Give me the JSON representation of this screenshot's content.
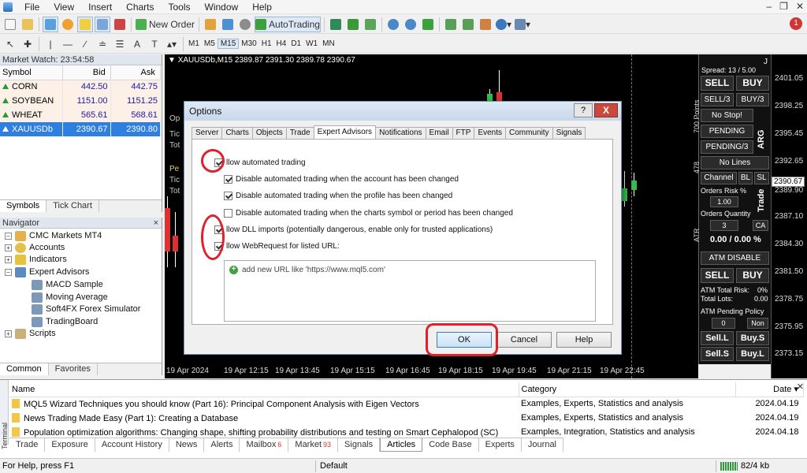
{
  "menu": [
    "File",
    "View",
    "Insert",
    "Charts",
    "Tools",
    "Window",
    "Help"
  ],
  "toolbar": {
    "new_order": "New Order",
    "autotrading": "AutoTrading"
  },
  "timeframes": [
    "M1",
    "M5",
    "M15",
    "M30",
    "H1",
    "H4",
    "D1",
    "W1",
    "MN"
  ],
  "notification_count": "1",
  "market_watch": {
    "title": "Market Watch: 23:54:58",
    "headers": [
      "Symbol",
      "Bid",
      "Ask"
    ],
    "rows": [
      {
        "symbol": "CORN",
        "bid": "442.50",
        "ask": "442.75"
      },
      {
        "symbol": "SOYBEAN",
        "bid": "1151.00",
        "ask": "1151.25"
      },
      {
        "symbol": "WHEAT",
        "bid": "565.61",
        "ask": "568.61"
      },
      {
        "symbol": "XAUUSDb",
        "bid": "2390.67",
        "ask": "2390.80"
      }
    ],
    "tabs": [
      "Symbols",
      "Tick Chart"
    ]
  },
  "navigator": {
    "title": "Navigator",
    "close": "×",
    "items": [
      "CMC Markets MT4",
      "Accounts",
      "Indicators",
      "Expert Advisors",
      "MACD Sample",
      "Moving Average",
      "Soft4FX Forex Simulator",
      "TradingBoard",
      "Scripts"
    ],
    "tabs": [
      "Common",
      "Favorites"
    ]
  },
  "chart": {
    "header": "XAUUSDb,M15  2389.87 2391.30 2389.78 2390.67",
    "hints": [
      "Op",
      "Pe",
      "Tic",
      "Tot",
      "Tic",
      "Tot"
    ],
    "x_labels": [
      "19 Apr 2024",
      "19 Apr 12:15",
      "19 Apr 13:45",
      "19 Apr 15:15",
      "19 Apr 16:45",
      "19 Apr 18:15",
      "19 Apr 19:45",
      "19 Apr 21:15",
      "19 Apr 22:45"
    ],
    "price_labels": [
      "2401.05",
      "2398.25",
      "2395.45",
      "2392.65",
      "2389.90",
      "2387.10",
      "2384.30",
      "2381.50",
      "2378.75",
      "2375.95",
      "2373.15"
    ],
    "current_price": "2390.67"
  },
  "panel": {
    "spread": "Spread: 13 / 5.00",
    "j": "J",
    "sell": "SELL",
    "buy": "BUY",
    "sell3": "SELL/3",
    "buy3": "BUY/3",
    "nostop": "No Stop!",
    "pending": "PENDING",
    "pending3": "PENDING/3",
    "nolines": "No Lines",
    "channel": "Channel",
    "bl": "BL",
    "sl": "SL",
    "orders_risk": "Orders Risk %",
    "risk_value": "1.00",
    "orders_qty": "Orders Quantity",
    "qty_value": "3",
    "ca": "CA",
    "pct": "0.00 / 0.00 %",
    "atm_disable": "ATM DISABLE",
    "sell2": "SELL",
    "buy2": "BUY",
    "atm_total_risk": "ATM Total Risk:",
    "atm_total_risk_val": "0%",
    "total_lots": "Total Lots:",
    "total_lots_val": "0.00",
    "atm_pending": "ATM Pending Policy",
    "pending_val": "0",
    "non": "Non",
    "sell_l": "Sell.L",
    "buy_s": "Buy.S",
    "sell_s": "Sell.S",
    "buy_l": "Buy.L",
    "v_700": "700 Points",
    "v_arg": "ARG",
    "v_478": "478",
    "v_trade": "Trade",
    "v_atr": "ATR"
  },
  "dialog": {
    "title": "Options",
    "help": "?",
    "close": "X",
    "tabs": [
      "Server",
      "Charts",
      "Objects",
      "Trade",
      "Expert Advisors",
      "Notifications",
      "Email",
      "FTP",
      "Events",
      "Community",
      "Signals"
    ],
    "active_tab": "Expert Advisors",
    "options": [
      {
        "label": "llow automated trading",
        "checked": true
      },
      {
        "label": "Disable automated trading when the account has been changed",
        "checked": true
      },
      {
        "label": "Disable automated trading when the profile has been changed",
        "checked": true
      },
      {
        "label": "Disable automated trading when the charts symbol or period has been changed",
        "checked": false
      },
      {
        "label": "llow DLL imports (potentially dangerous, enable only for trusted applications)",
        "checked": true
      },
      {
        "label": "llow WebRequest for listed URL:",
        "checked": true
      }
    ],
    "url_placeholder": "add new URL like 'https://www.mql5.com'",
    "ok": "OK",
    "cancel": "Cancel",
    "help_btn": "Help"
  },
  "terminal": {
    "label": "Terminal",
    "headers": [
      "Name",
      "Category",
      "Date"
    ],
    "rows": [
      {
        "name": "MQL5 Wizard Techniques you should know (Part 16): Principal Component Analysis with Eigen Vectors",
        "category": "Examples, Experts, Statistics and analysis",
        "date": "2024.04.19"
      },
      {
        "name": "News Trading Made Easy (Part 1): Creating a Database",
        "category": "Examples, Experts, Statistics and analysis",
        "date": "2024.04.19"
      },
      {
        "name": "Population optimization algorithms: Changing shape, shifting probability distributions and testing on Smart Cephalopod (SC)",
        "category": "Examples, Integration, Statistics and analysis",
        "date": "2024.04.18"
      }
    ],
    "tabs": [
      {
        "label": "Trade",
        "badge": ""
      },
      {
        "label": "Exposure",
        "badge": ""
      },
      {
        "label": "Account History",
        "badge": ""
      },
      {
        "label": "News",
        "badge": ""
      },
      {
        "label": "Alerts",
        "badge": ""
      },
      {
        "label": "Mailbox",
        "badge": "6"
      },
      {
        "label": "Market",
        "badge": "93"
      },
      {
        "label": "Signals",
        "badge": ""
      },
      {
        "label": "Articles",
        "badge": ""
      },
      {
        "label": "Code Base",
        "badge": ""
      },
      {
        "label": "Experts",
        "badge": ""
      },
      {
        "label": "Journal",
        "badge": ""
      }
    ],
    "active_tab": "Articles"
  },
  "status": {
    "help": "For Help, press F1",
    "profile": "Default",
    "traffic": "82/4 kb"
  },
  "colors": {
    "annotation": "#e0202a",
    "selected_row": "#2f7fe0",
    "bid_ask": "#1a1aa8"
  }
}
